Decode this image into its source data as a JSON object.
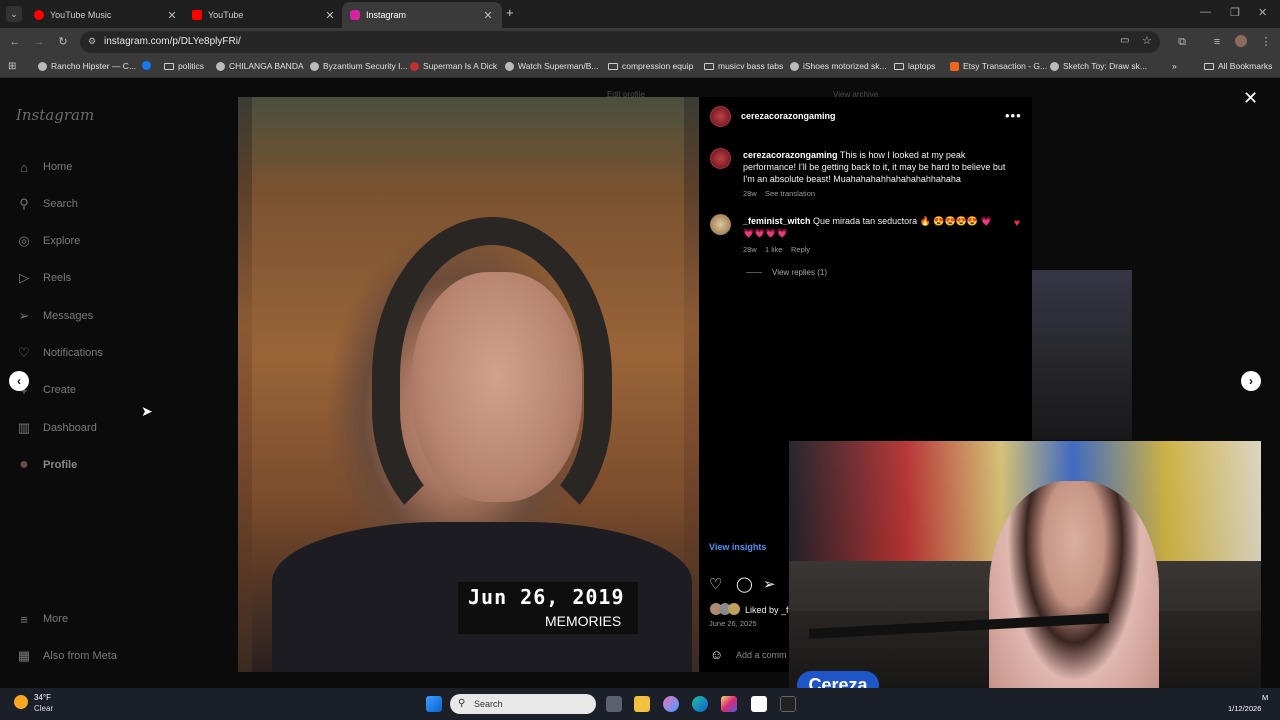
{
  "browser": {
    "tabs": [
      {
        "title": "YouTube Music",
        "color": "#ff0000"
      },
      {
        "title": "YouTube",
        "color": "#ff0000"
      },
      {
        "title": "Instagram",
        "color": "#d6249f"
      }
    ],
    "new_tab": "+",
    "url": "instagram.com/p/DLYe8plyFRi/",
    "bookmarks": [
      "Rancho Hipster — C...",
      "politics",
      "CHILANGA BANDA",
      "Byzantium Security I...",
      "Superman Is A Dick",
      "Watch Superman/B...",
      "compression equip",
      "musicv bass tabs",
      "iShoes motorized sk...",
      "laptops",
      "Etsy Transaction - G...",
      "Sketch Toy: Draw sk..."
    ],
    "all_bookmarks": "All Bookmarks",
    "more_bookmarks": "»"
  },
  "instagram": {
    "logo": "Instagram",
    "nav": [
      {
        "label": "Home",
        "icon": "⌂"
      },
      {
        "label": "Search",
        "icon": "⚲"
      },
      {
        "label": "Explore",
        "icon": "◎"
      },
      {
        "label": "Reels",
        "icon": "▷"
      },
      {
        "label": "Messages",
        "icon": "➢"
      },
      {
        "label": "Notifications",
        "icon": "♡"
      },
      {
        "label": "Create",
        "icon": "+"
      },
      {
        "label": "Dashboard",
        "icon": "▥"
      },
      {
        "label": "Profile",
        "icon": "●"
      }
    ],
    "bottom_nav": [
      {
        "label": "More",
        "icon": "≡"
      },
      {
        "label": "Also from Meta",
        "icon": "▦"
      }
    ],
    "bg_edit_profile": "Edit profile",
    "bg_view_archive": "View archive"
  },
  "post": {
    "username": "cerezacorazongaming",
    "more": "•••",
    "photo_date": "Jun 26, 2019",
    "photo_label": "MEMORIES",
    "caption_user": "cerezacorazongaming",
    "caption_text": "This is how I looked at my peak performance! I'll be getting back to it, it may be hard to believe but I'm an absolute beast! Muahahahahhahahahahhahaha",
    "caption_age": "28w",
    "see_translation": "See translation",
    "comment_user": "_feminist_witch",
    "comment_text": "Que mirada tan seductora 🔥 😍😍😍😍 💗 💗💗💗💗",
    "comment_age": "28w",
    "comment_likes": "1 like",
    "reply": "Reply",
    "view_replies": "View replies (1)",
    "view_insights": "View insights",
    "liked_by": "Liked by _f",
    "date": "June 26, 2025",
    "add_comment": "Add a comm",
    "close": "✕",
    "prev": "‹",
    "next": "›"
  },
  "stream": {
    "badge": "Cereza"
  },
  "taskbar": {
    "temp": "34°F",
    "condition": "Clear",
    "search_placeholder": "Search",
    "clock_partial": "M",
    "date": "1/12/2026"
  }
}
